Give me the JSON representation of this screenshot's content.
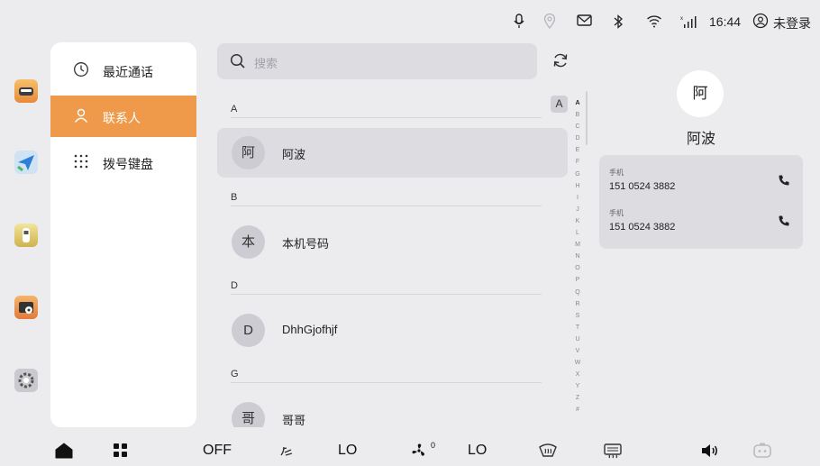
{
  "status_bar": {
    "time": "16:44",
    "login": "未登录",
    "icons": [
      "microphone-icon",
      "location-icon",
      "message-icon",
      "bluetooth-icon",
      "wifi-icon",
      "signal-icon",
      "user-icon"
    ]
  },
  "dock": {
    "apps": [
      "car-app-icon",
      "navigation-app-icon",
      "vehicle-app-icon",
      "media-app-icon",
      "settings-app-icon"
    ]
  },
  "nav": {
    "items": [
      {
        "label": "最近通话",
        "icon": "clock-icon",
        "active": false
      },
      {
        "label": "联系人",
        "icon": "person-icon",
        "active": true
      },
      {
        "label": "拨号键盘",
        "icon": "keypad-icon",
        "active": false
      }
    ]
  },
  "search": {
    "placeholder": "搜索"
  },
  "contacts": {
    "sections": [
      {
        "letter": "A",
        "items": [
          {
            "avatar": "阿",
            "name": "阿波",
            "selected": true
          }
        ]
      },
      {
        "letter": "B",
        "items": [
          {
            "avatar": "本",
            "name": "本机号码",
            "selected": false
          }
        ]
      },
      {
        "letter": "D",
        "items": [
          {
            "avatar": "D",
            "name": "DhhGjofhjf",
            "selected": false
          }
        ]
      },
      {
        "letter": "G",
        "items": [
          {
            "avatar": "哥",
            "name": "哥哥",
            "selected": false
          }
        ]
      }
    ]
  },
  "alphabet": {
    "current": "A",
    "letters": [
      "A",
      "B",
      "C",
      "D",
      "E",
      "F",
      "G",
      "H",
      "I",
      "J",
      "K",
      "L",
      "M",
      "N",
      "O",
      "P",
      "Q",
      "R",
      "S",
      "T",
      "U",
      "V",
      "W",
      "X",
      "Y",
      "Z",
      "#"
    ]
  },
  "detail": {
    "avatar": "阿",
    "name": "阿波",
    "phones": [
      {
        "type": "手机",
        "number": "151 0524 3882"
      },
      {
        "type": "手机",
        "number": "151 0524 3882"
      }
    ]
  },
  "bottom_bar": {
    "ac_status": "OFF",
    "left_temp": "LO",
    "fan_level": "0",
    "right_temp": "LO",
    "icons": [
      "home-icon",
      "apps-grid-icon",
      "airflow-icon",
      "fan-icon",
      "front-defrost-icon",
      "rear-defrost-icon",
      "volume-icon",
      "assistant-icon"
    ]
  },
  "colors": {
    "accent": "#ef9a4a",
    "background": "#ececef",
    "card": "#ffffff",
    "row_selected": "#dcdce1"
  }
}
